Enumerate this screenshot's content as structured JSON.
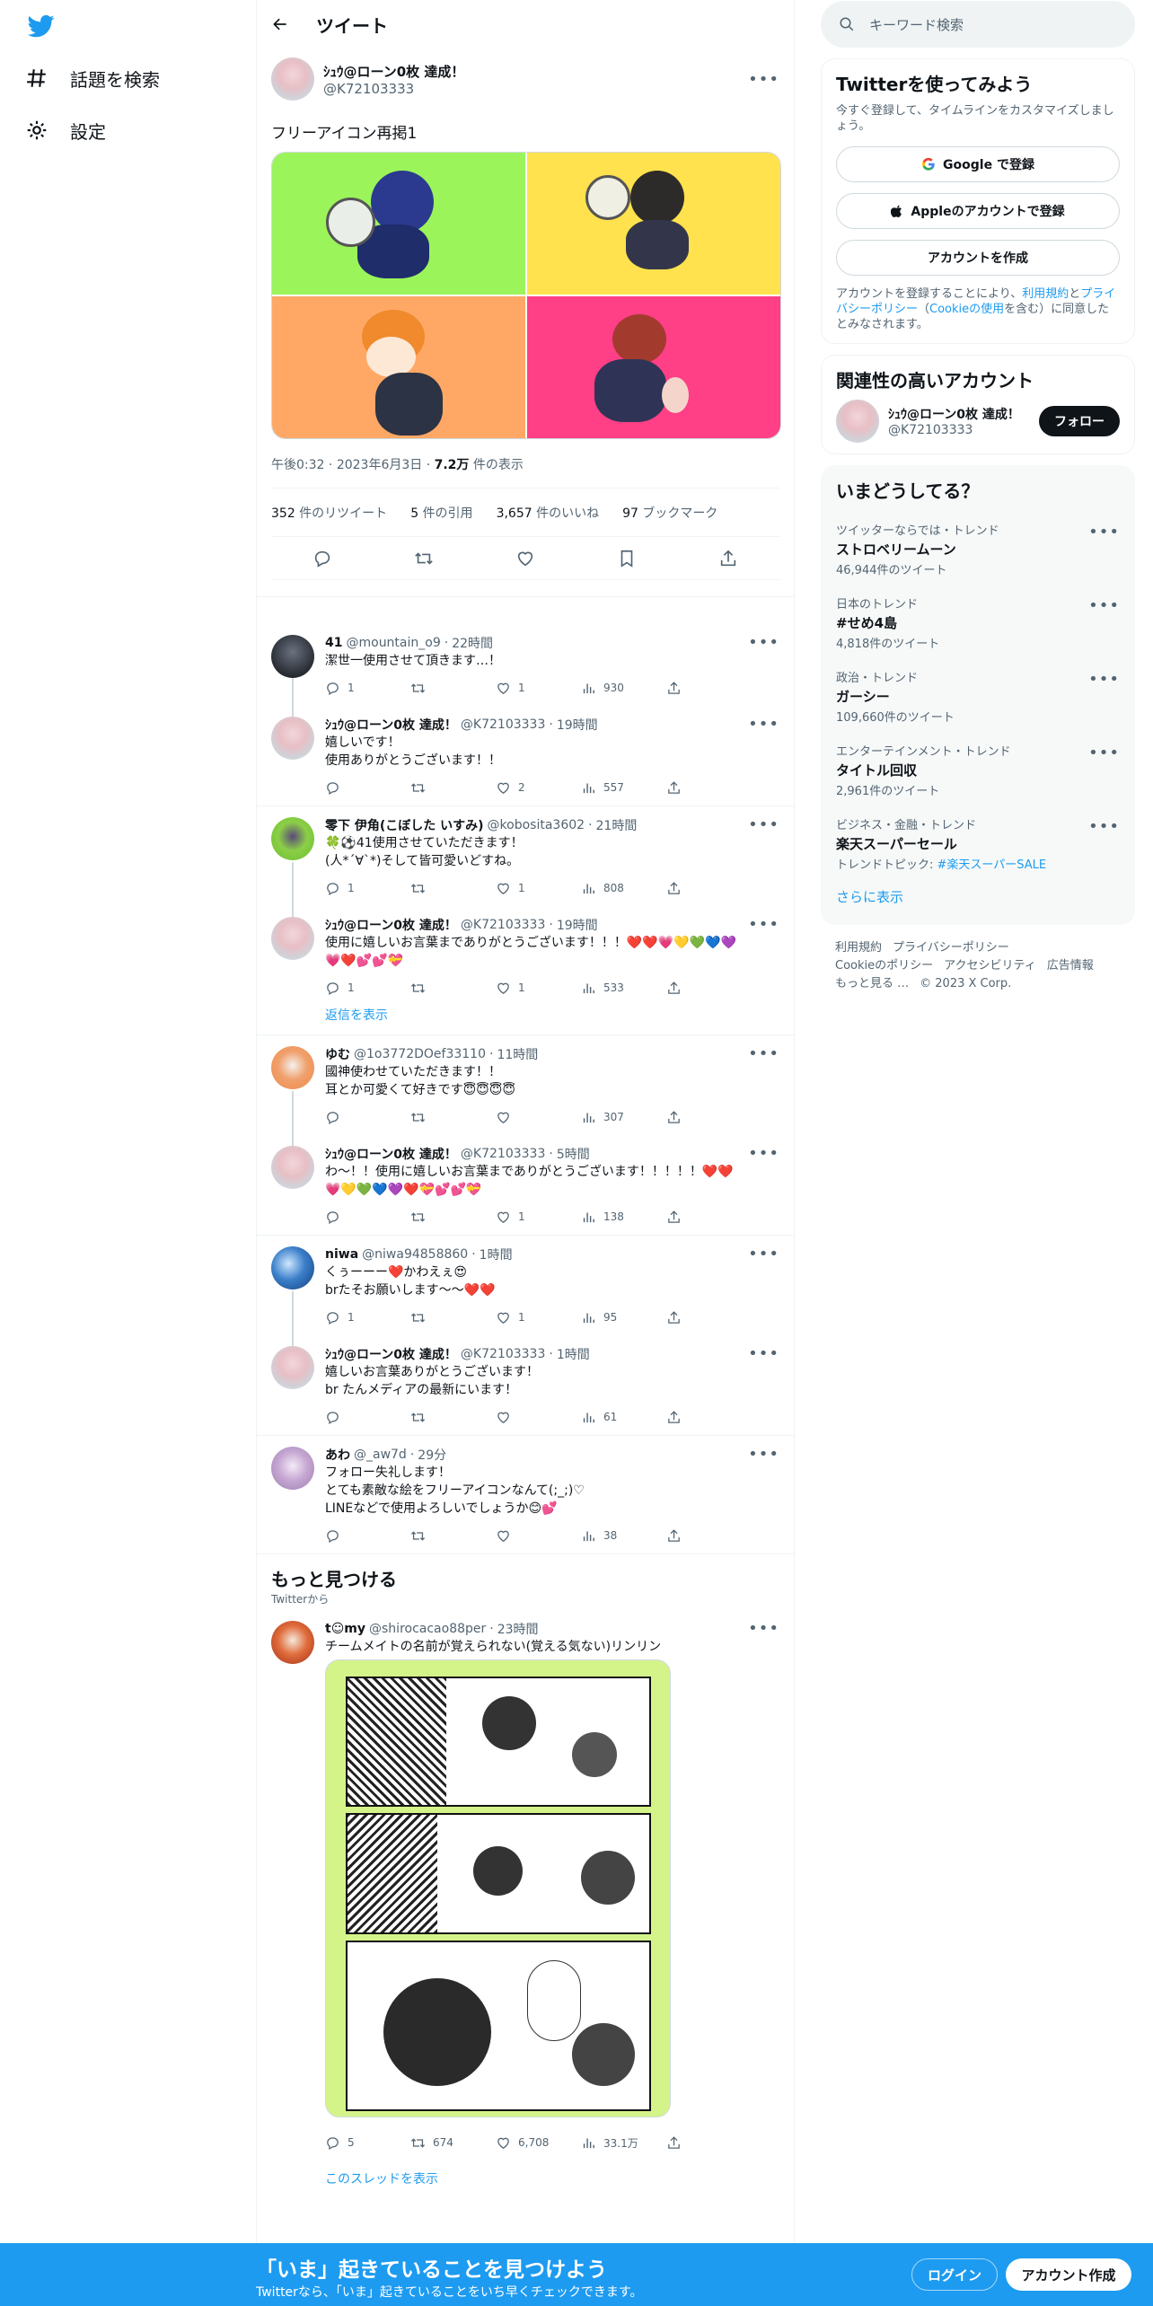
{
  "nav": {
    "explore_label": "話題を検索",
    "settings_label": "設定"
  },
  "header": {
    "title": "ツイート"
  },
  "main_tweet": {
    "name": "ｼｭｳ@ローン0枚 達成！",
    "handle": "@K72103333",
    "text": "フリーアイコン再掲1",
    "time": "午後0:32",
    "date": "2023年6月3日",
    "views_num": "7.2万",
    "views_label": "件の表示",
    "retweets": "352",
    "retweets_label": "件のリツイート",
    "quotes": "5",
    "quotes_label": "件の引用",
    "likes": "3,657",
    "likes_label": "件のいいね",
    "bookmarks": "97",
    "bookmarks_label": "ブックマーク"
  },
  "replies": [
    {
      "name": "41",
      "handle": "@mountain_o9",
      "time": "22時間",
      "text": "潔世一使用させて頂きます…！",
      "reply": "1",
      "retweet": "",
      "like": "1",
      "views": "930"
    },
    {
      "name": "ｼｭｳ@ローン0枚 達成！",
      "handle": "@K72103333",
      "time": "19時間",
      "text": "嬉しいです！\n使用ありがとうございます！！",
      "reply": "",
      "retweet": "",
      "like": "2",
      "views": "557"
    },
    {
      "name": "零下 伊角(こぼした いすみ)",
      "handle": "@kobosita3602",
      "time": "21時間",
      "text": "🍀⚽41使用させていただきます！\n(人*´∀`*)そして皆可愛いどすね。",
      "reply": "1",
      "retweet": "",
      "like": "1",
      "views": "808"
    },
    {
      "name": "ｼｭｳ@ローン0枚 達成！",
      "handle": "@K72103333",
      "time": "19時間",
      "text": "使用に嬉しいお言葉までありがとうございます！！！❤️❤️💗💛💚💙💜\n💗❤️💕💕💝",
      "reply": "1",
      "retweet": "",
      "like": "1",
      "views": "533"
    },
    {
      "name": "ゆむ",
      "handle": "@1o3772DOef33110",
      "time": "11時間",
      "text": "國神使わせていただきます！！\n耳とか可愛くて好きです😇😇😇😇",
      "reply": "",
      "retweet": "",
      "like": "",
      "views": "307"
    },
    {
      "name": "ｼｭｳ@ローン0枚 達成！",
      "handle": "@K72103333",
      "time": "5時間",
      "text": "わ〜！！使用に嬉しいお言葉までありがとうございます！！！！！❤️❤️\n💗💛💚💙💜❤️💝💕💕💝",
      "reply": "",
      "retweet": "",
      "like": "1",
      "views": "138"
    },
    {
      "name": "niwa",
      "handle": "@niwa94858860",
      "time": "1時間",
      "text": "くぅーーー❤️かわえぇ😍\nbrたそお願いします〜〜❤️❤️",
      "reply": "1",
      "retweet": "",
      "like": "1",
      "views": "95"
    },
    {
      "name": "ｼｭｳ@ローン0枚 達成！",
      "handle": "@K72103333",
      "time": "1時間",
      "text": "嬉しいお言葉ありがとうございます！\nbr たんメディアの最新にいます！",
      "reply": "",
      "retweet": "",
      "like": "",
      "views": "61"
    },
    {
      "name": "あわ",
      "handle": "@_aw7d",
      "time": "29分",
      "text": "フォロー失礼します！\nとても素敵な絵をフリーアイコンなんて(;_;)♡\nLINEなどで使用よろしいでしょうか😊💕",
      "reply": "",
      "retweet": "",
      "like": "",
      "views": "38"
    }
  ],
  "show_replies": "返信を表示",
  "discover": {
    "title": "もっと見つける",
    "subtitle": "Twitterから",
    "tweet": {
      "name": "t☺my",
      "handle": "@shirocacao88per",
      "time": "23時間",
      "text": "チームメイトの名前が覚えられない(覚える気ない)リンリン",
      "reply": "5",
      "retweet": "674",
      "like": "6,708",
      "views": "33.1万"
    },
    "thread_link": "このスレッドを表示"
  },
  "sidebar": {
    "search_placeholder": "キーワード検索",
    "signup_title": "Twitterを使ってみよう",
    "signup_sub": "今すぐ登録して、タイムラインをカスタマイズしましょう。",
    "google_btn": "Google で登録",
    "apple_btn": "Appleのアカウントで登録",
    "create_btn": "アカウントを作成",
    "terms_pre": "アカウントを登録することにより、",
    "terms_link1": "利用規約",
    "terms_mid1": "と",
    "terms_link2": "プライバシーポリシー",
    "terms_mid2": "（",
    "terms_link3": "Cookieの使用",
    "terms_post": "を含む）に同意したとみなされます。",
    "related_title": "関連性の高いアカウント",
    "related_name": "ｼｭｳ@ローン0枚 達成！",
    "related_handle": "@K72103333",
    "follow_btn": "フォロー",
    "trends_title": "いまどうしてる？",
    "trends": [
      {
        "context": "ツイッターならでは・トレンド",
        "name": "ストロベリームーン",
        "count": "46,944件のツイート",
        "topic_label": "",
        "topic_link": ""
      },
      {
        "context": "日本のトレンド",
        "name": "#せめ4島",
        "count": "4,818件のツイート",
        "topic_label": "",
        "topic_link": ""
      },
      {
        "context": "政治・トレンド",
        "name": "ガーシー",
        "count": "109,660件のツイート",
        "topic_label": "",
        "topic_link": ""
      },
      {
        "context": "エンターテインメント・トレンド",
        "name": "タイトル回収",
        "count": "2,961件のツイート",
        "topic_label": "",
        "topic_link": ""
      },
      {
        "context": "ビジネス・金融・トレンド",
        "name": "楽天スーパーセール",
        "count": "",
        "topic_label": "トレンドトピック: ",
        "topic_link": "#楽天スーパーSALE"
      }
    ],
    "show_more": "さらに表示",
    "footer": [
      "利用規約",
      "プライバシーポリシー",
      "Cookieのポリシー",
      "アクセシビリティ",
      "広告情報",
      "もっと見る …",
      "© 2023 X Corp."
    ]
  },
  "bottom_bar": {
    "title": "「いま」起きていることを見つけよう",
    "subtitle": "Twitterなら、「いま」起きていることをいち早くチェックできます。",
    "login": "ログイン",
    "signup": "アカウント作成"
  },
  "colors": {
    "accent": "#1d9bf0",
    "text": "#0f1419",
    "muted": "#536471"
  }
}
